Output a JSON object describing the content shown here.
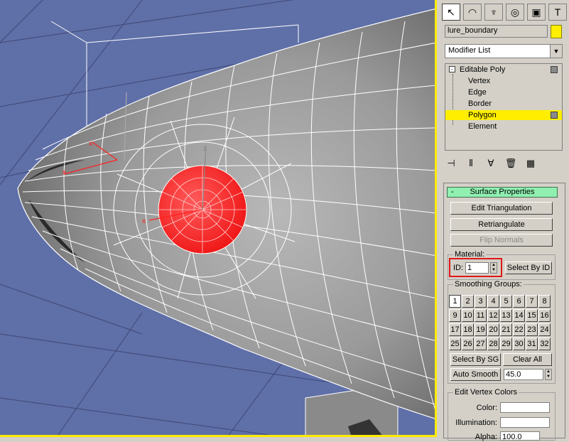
{
  "command_panel": {
    "tabs": [
      {
        "name": "create",
        "glyph": "↖"
      },
      {
        "name": "modify",
        "glyph": "◠"
      },
      {
        "name": "hierarchy",
        "glyph": "♆"
      },
      {
        "name": "motion",
        "glyph": "◎"
      },
      {
        "name": "display",
        "glyph": "▣"
      },
      {
        "name": "utilities",
        "glyph": "T"
      }
    ],
    "object_name": "lure_boundary",
    "object_color": "#ffee00",
    "modifier_list_label": "Modifier List",
    "stack": {
      "root": "Editable Poly",
      "sub_objects": [
        "Vertex",
        "Edge",
        "Border",
        "Polygon",
        "Element"
      ],
      "selected": "Polygon"
    }
  },
  "surface_properties": {
    "title": "Surface Properties",
    "collapse_symbol": "-",
    "edit_triangulation": "Edit Triangulation",
    "retriangulate": "Retriangulate",
    "flip_normals": "Flip Normals",
    "material_group_title": "Material:",
    "id_label": "ID:",
    "id_value": "1",
    "select_by_id": "Select By ID",
    "smoothing_groups_title": "Smoothing Groups:",
    "smoothing_groups": [
      "1",
      "2",
      "3",
      "4",
      "5",
      "6",
      "7",
      "8",
      "9",
      "10",
      "11",
      "12",
      "13",
      "14",
      "15",
      "16",
      "17",
      "18",
      "19",
      "20",
      "21",
      "22",
      "23",
      "24",
      "25",
      "26",
      "27",
      "28",
      "29",
      "30",
      "31",
      "32"
    ],
    "active_group": "1",
    "select_by_sg": "Select By SG",
    "clear_all": "Clear All",
    "auto_smooth": "Auto Smooth",
    "auto_smooth_value": "45.0",
    "edit_vertex_colors_title": "Edit Vertex Colors",
    "color_label": "Color:",
    "illumination_label": "Illumination:",
    "alpha_label": "Alpha:",
    "alpha_value": "100.0"
  },
  "colors": {
    "viewport_bg": "#5f6fa8",
    "selection_red": "#ff2020",
    "active_border": "#ffea00",
    "rollout_header": "#8ff0b0"
  }
}
